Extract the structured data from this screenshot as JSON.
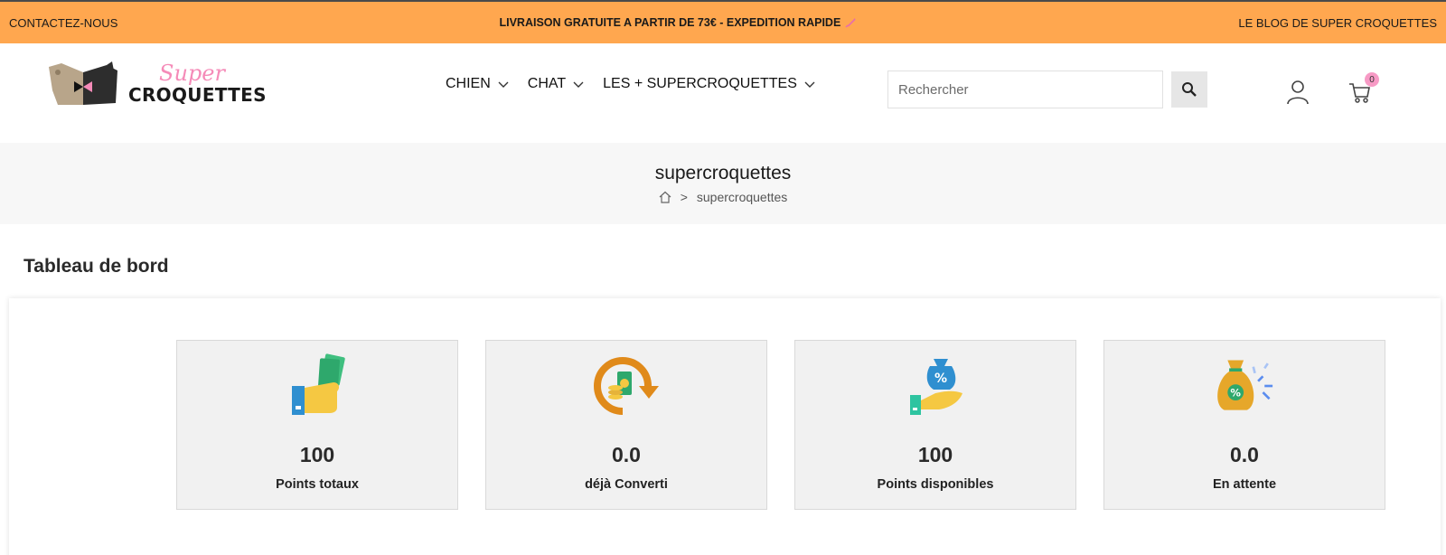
{
  "topbar": {
    "contact": "CONTACTEZ-NOUS",
    "promo": "LIVRAISON GRATUITE A PARTIR DE 73€ - EXPEDITION RAPIDE",
    "blog": "LE BLOG DE SUPER CROQUETTES"
  },
  "logo": {
    "line1": "Super",
    "line2": "CROQUETTES"
  },
  "nav": [
    {
      "label": "CHIEN"
    },
    {
      "label": "CHAT"
    },
    {
      "label": "LES + SUPERCROQUETTES"
    }
  ],
  "search": {
    "placeholder": "Rechercher",
    "value": ""
  },
  "cart": {
    "count": "0"
  },
  "page": {
    "title": "supercroquettes",
    "breadcrumb_current": "supercroquettes",
    "breadcrumb_sep": ">"
  },
  "dashboard": {
    "title": "Tableau de bord",
    "cards": [
      {
        "value": "100",
        "label": "Points totaux",
        "icon": "hand-cash-icon"
      },
      {
        "value": "0.0",
        "label": "déjà Converti",
        "icon": "money-convert-icon"
      },
      {
        "value": "100",
        "label": "Points disponibles",
        "icon": "hand-money-bag-icon"
      },
      {
        "value": "0.0",
        "label": "En attente",
        "icon": "money-bag-pending-icon"
      }
    ]
  },
  "colors": {
    "topbar": "#ffa74f",
    "accent_pink": "#f58bb8",
    "band": "#f7f7f7",
    "card_bg": "#f1f1f1"
  }
}
